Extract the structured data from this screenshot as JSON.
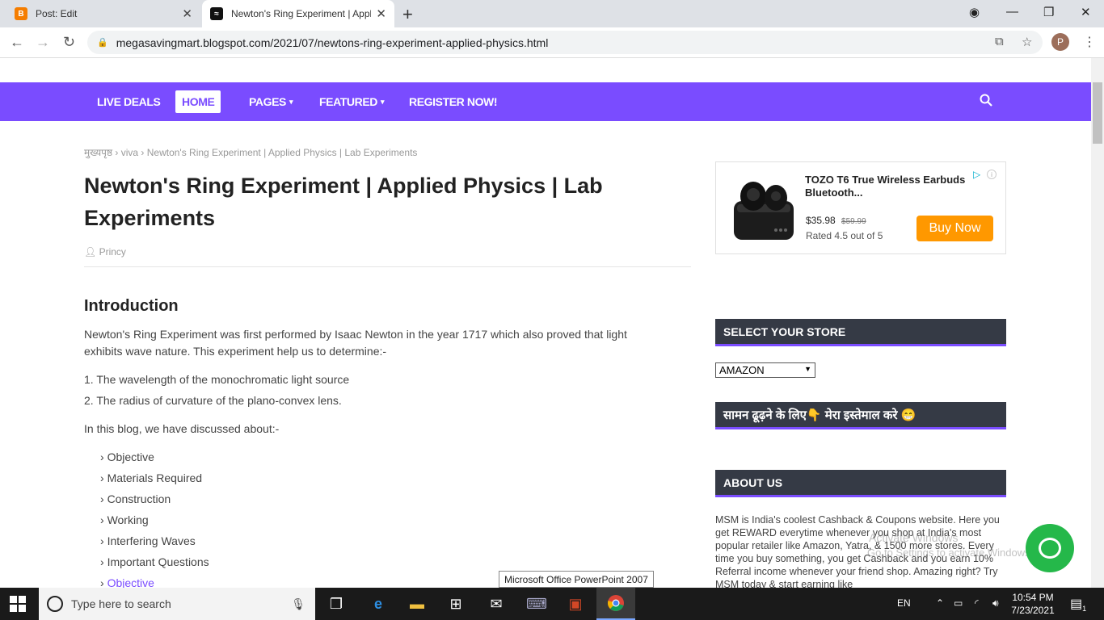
{
  "browser": {
    "tabs": [
      {
        "title": "Post: Edit",
        "favicon": "B"
      },
      {
        "title": "Newton's Ring Experiment | Appl",
        "favicon": "≈"
      }
    ],
    "url": "megasavingmart.blogspot.com/2021/07/newtons-ring-experiment-applied-physics.html",
    "profile_initial": "P"
  },
  "nav": {
    "items": [
      "LIVE DEALS",
      "HOME",
      "PAGES",
      "FEATURED",
      "REGISTER NOW!"
    ]
  },
  "breadcrumb": {
    "home": "मुख्यपृष्ठ",
    "category": "viva",
    "current": "Newton's Ring Experiment | Applied Physics | Lab Experiments"
  },
  "post": {
    "title": "Newton's Ring Experiment | Applied Physics | Lab Experiments",
    "author": "Princy",
    "intro_heading": "Introduction",
    "intro_para": "Newton's Ring Experiment was first performed by Isaac Newton in the year 1717 which also proved that light exhibits wave nature. This experiment help us to determine:-",
    "points": [
      "1. The wavelength of the monochromatic light source",
      "2. The radius of curvature of the plano-convex lens."
    ],
    "discussed": "In this blog, we have discussed about:-",
    "toc": [
      "Objective",
      "Materials Required",
      "Construction",
      "Working",
      "Interfering Waves",
      "Important Questions",
      "Objective"
    ]
  },
  "ad": {
    "title": "TOZO T6 True Wireless Earbuds Bluetooth...",
    "price": "$35.98",
    "old_price": "$59.99",
    "rating": "Rated 4.5 out of 5",
    "button": "Buy Now"
  },
  "sidebar": {
    "store_heading": "SELECT YOUR STORE",
    "store_selected": "AMAZON",
    "search_heading": "सामन ढूढ़ने के लिए👇 मेरा इस्तेमाल करे 😁",
    "about_heading": "ABOUT US",
    "about_text": "MSM is India's coolest Cashback & Coupons website. Here you get REWARD everytime whenever you shop at India's most popular retailer like Amazon, Yatra, & 1500 more stores. Every time you buy something, you get Cashback and you earn 10% Referral income whenever your friend shop. Amazing right? Try MSM today & start earning like"
  },
  "overlay": {
    "watermark_title": "Activate Windows",
    "watermark_sub": "Go to Settings to activate Windows.",
    "tooltip": "Microsoft Office PowerPoint 2007"
  },
  "taskbar": {
    "search_placeholder": "Type here to search",
    "lang": "EN",
    "time": "10:54 PM",
    "date": "7/23/2021",
    "notifications": "1"
  },
  "colors": {
    "accent": "#7a4cff",
    "widget_bg": "#353a45",
    "buy_button": "#ff9800",
    "chat": "#25b84a"
  }
}
